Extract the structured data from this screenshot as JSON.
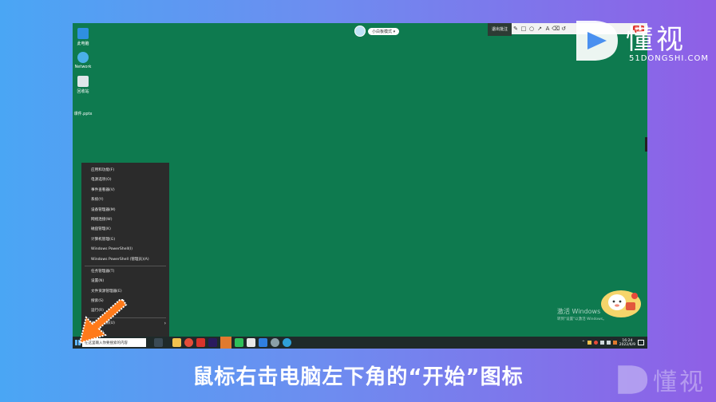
{
  "desktop": {
    "icons": [
      {
        "label": "此电脑",
        "icon": "computer-icon",
        "color": "#2f8fe0"
      },
      {
        "label": "Network",
        "icon": "network-icon",
        "color": "#4ab0e8"
      },
      {
        "label": "回收站",
        "icon": "recycle-bin-icon",
        "color": "#dfe6ea"
      },
      {
        "label": "课件.pptx",
        "icon": "file-icon",
        "color": "#0e7a4f"
      }
    ],
    "top_widget_label": "小白板模式 ▾",
    "draw_bar": {
      "mode_label": "退出批注",
      "tools": [
        "✎",
        "□",
        "○",
        "↗",
        "A",
        "⌫",
        "↺"
      ],
      "rec_label": "录屏"
    },
    "activate_line1": "激活 Windows",
    "activate_line2": "转到\"设置\"以激活 Windows。"
  },
  "context_menu": {
    "group1": [
      "应用和功能(F)",
      "电源选项(O)",
      "事件查看器(V)",
      "系统(Y)",
      "设备管理器(M)",
      "网络连接(W)",
      "磁盘管理(K)",
      "计算机管理(G)",
      "Windows PowerShell(I)",
      "Windows PowerShell (管理员)(A)"
    ],
    "group2": [
      "任务管理器(T)",
      "设置(N)",
      "文件资源管理器(E)",
      "搜索(S)",
      "运行(R)"
    ],
    "group3": [
      "关机或注销(U)"
    ],
    "group3_arrow": "›",
    "group4": [
      "桌面(D)"
    ]
  },
  "taskbar": {
    "search_placeholder": "在这里输入你要搜索的内容",
    "apps": [
      {
        "icon": "task-view-icon",
        "color": "#3a4a55"
      },
      {
        "icon": "file-explorer-icon",
        "color": "#f2c14e"
      },
      {
        "icon": "chrome-icon",
        "color": "#e44d3a"
      },
      {
        "icon": "app-red-icon",
        "color": "#d8342c"
      },
      {
        "icon": "premiere-icon",
        "color": "#2a1a5e"
      },
      {
        "icon": "whiteboard-icon",
        "color": "#e07a2f"
      },
      {
        "icon": "wechat-icon",
        "color": "#2fbf5a"
      },
      {
        "icon": "app-white-icon",
        "color": "#e8e8e8"
      },
      {
        "icon": "app-blue-icon",
        "color": "#2f7fe0"
      },
      {
        "icon": "app-gray-icon",
        "color": "#8aa0a8"
      },
      {
        "icon": "edge-icon",
        "color": "#2fa0d8"
      }
    ],
    "time": "16:24",
    "date": "2022/6/9"
  },
  "logo": {
    "word": "懂视",
    "sub": "51DONGSHI.COM"
  },
  "caption": "鼠标右击电脑左下角的“开始”图标"
}
